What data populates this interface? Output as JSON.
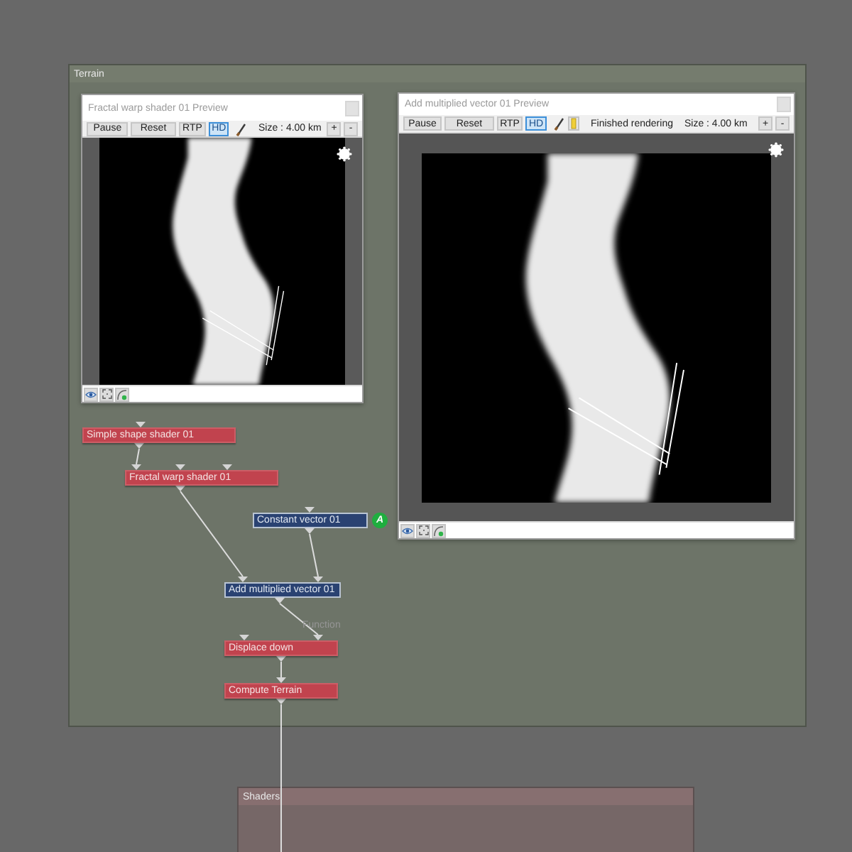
{
  "canvas": {
    "groups": [
      {
        "title": "Terrain",
        "kind": "terrain"
      },
      {
        "title": "Shaders",
        "kind": "shaders"
      }
    ]
  },
  "previews": [
    {
      "title": "Fractal warp shader 01 Preview",
      "buttons": [
        {
          "label": "Pause",
          "selected": false
        },
        {
          "label": "Reset",
          "selected": false
        },
        {
          "label": "RTP",
          "selected": false
        },
        {
          "label": "HD",
          "selected": true
        }
      ],
      "tools": [
        {
          "kind": "brush"
        }
      ],
      "size": "Size : 4.00 km",
      "zoom_buttons": [
        "+",
        "-"
      ]
    },
    {
      "title": "Add multiplied vector 01 Preview",
      "buttons": [
        {
          "label": "Pause",
          "selected": false
        },
        {
          "label": "Reset",
          "selected": false
        },
        {
          "label": "RTP",
          "selected": false
        },
        {
          "label": "HD",
          "selected": true
        }
      ],
      "tools": [
        {
          "kind": "brush"
        },
        {
          "kind": "meter"
        }
      ],
      "status": "Finished rendering",
      "size": "Size : 4.00 km",
      "zoom_buttons": [
        "+",
        "-"
      ]
    }
  ],
  "nodes": [
    {
      "label": "Simple shape shader 01",
      "kind": "shader"
    },
    {
      "label": "Fractal warp shader 01",
      "kind": "shader"
    },
    {
      "label": "Constant vector 01",
      "kind": "vector",
      "badge": "A"
    },
    {
      "label": "Add multiplied vector 01",
      "kind": "vector"
    },
    {
      "label": "Displace down",
      "kind": "shader",
      "input_label": "Function"
    },
    {
      "label": "Compute Terrain",
      "kind": "shader"
    }
  ]
}
